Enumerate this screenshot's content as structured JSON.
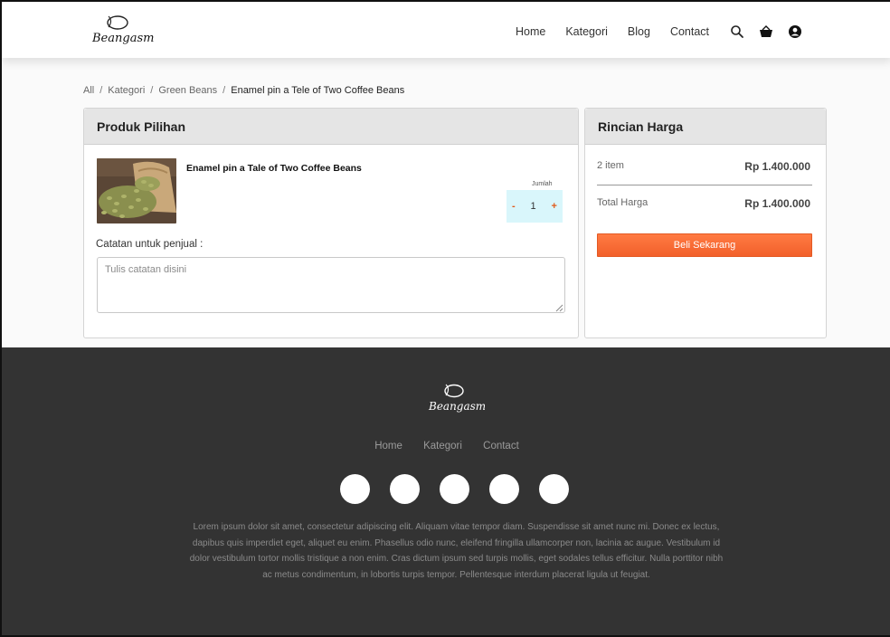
{
  "brand": {
    "logo_text": "Beangasm"
  },
  "nav": {
    "links": [
      "Home",
      "Kategori",
      "Blog",
      "Contact"
    ],
    "icons": [
      "search-icon",
      "basket-icon",
      "user-icon"
    ]
  },
  "breadcrumb": {
    "items": [
      "All",
      "Kategori",
      "Green Beans"
    ],
    "current": "Enamel pin a Tele of Two Coffee Beans",
    "separator": "/"
  },
  "product_card": {
    "title": "Produk Pilihan",
    "product_name": "Enamel pin a Tale of Two Coffee Beans",
    "quantity_label": "Jumlah",
    "quantity": "1",
    "minus": "-",
    "plus": "+",
    "note_label": "Catatan untuk penjual :",
    "note_placeholder": "Tulis catatan disini"
  },
  "price_card": {
    "title": "Rincian Harga",
    "items_label": "2 item",
    "items_value": "Rp 1.400.000",
    "total_label": "Total Harga",
    "total_value": "Rp 1.400.000",
    "buy_label": "Beli Sekarang"
  },
  "footer": {
    "logo_text": "Beangasm",
    "links": [
      "Home",
      "Kategori",
      "Contact"
    ],
    "social_count": 5,
    "text": "Lorem ipsum dolor sit amet, consectetur adipiscing elit. Aliquam vitae tempor diam. Suspendisse sit amet nunc mi. Donec ex lectus, dapibus quis imperdiet eget, aliquet eu enim. Phasellus odio nunc, eleifend fringilla ullamcorper non, lacinia ac augue. Vestibulum id dolor vestibulum tortor mollis tristique a non enim. Cras dictum ipsum sed turpis mollis, eget sodales tellus efficitur. Nulla porttitor nibh ac metus condimentum, in lobortis turpis tempor. Pellentesque interdum placerat ligula ut feugiat."
  },
  "colors": {
    "accent": "#f46a33",
    "footer_bg": "#333333",
    "stepper_bg": "#d9f6fb"
  }
}
